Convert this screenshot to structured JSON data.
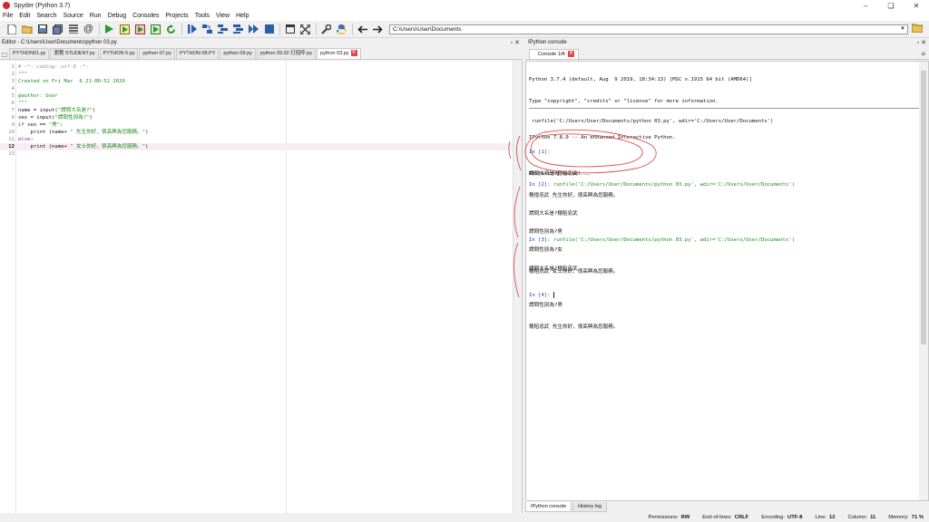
{
  "window": {
    "title": "Spyder (Python 3.7)",
    "minimize": "–",
    "maximize": "❏",
    "close": "✕"
  },
  "menu": [
    "File",
    "Edit",
    "Search",
    "Source",
    "Run",
    "Debug",
    "Consoles",
    "Projects",
    "Tools",
    "View",
    "Help"
  ],
  "toolbar": {
    "path": "C:\\Users\\User\\Documents",
    "icons": [
      "new-file-icon",
      "open-file-icon",
      "save-icon",
      "save-all-icon",
      "outline-icon",
      "at-icon",
      "run-icon",
      "run-cell-icon",
      "run-cell-advance-icon",
      "run-selection-icon",
      "rerun-icon",
      "debug-icon",
      "step-icon",
      "step-into-icon",
      "step-return-icon",
      "continue-icon",
      "stop-icon",
      "maximize-pane-icon",
      "fullscreen-icon",
      "preferences-icon",
      "python-path-icon",
      "back-arrow-icon",
      "forward-arrow-icon",
      "folder-icon"
    ]
  },
  "editor": {
    "title": "Editor - C:\\Users\\User\\Documents\\python 03.py",
    "tabs": [
      {
        "label": "PYTHON01.py",
        "active": false
      },
      {
        "label": "瀏覽 STUDENT.py",
        "active": false
      },
      {
        "label": "PYTHON 6.py",
        "active": false
      },
      {
        "label": "python 07.py",
        "active": false
      },
      {
        "label": "PYTHON 08.PY",
        "active": false
      },
      {
        "label": "python 09.py",
        "active": false
      },
      {
        "label": "python 09.02 打招呼.py",
        "active": false
      },
      {
        "label": "python 03.py",
        "active": true
      }
    ],
    "lines": [
      {
        "n": "1",
        "parts": [
          {
            "t": "# -*- coding: utf-8 -*-",
            "c": "c-com"
          }
        ]
      },
      {
        "n": "2",
        "parts": [
          {
            "t": "\"\"\"",
            "c": "c-str"
          }
        ]
      },
      {
        "n": "3",
        "parts": [
          {
            "t": "Created on Fri Mar  6 21:00:52 2020",
            "c": "c-str"
          }
        ]
      },
      {
        "n": "4",
        "parts": [
          {
            "t": "",
            "c": "c-str"
          }
        ]
      },
      {
        "n": "5",
        "parts": [
          {
            "t": "@author: User",
            "c": "c-str"
          }
        ]
      },
      {
        "n": "6",
        "parts": [
          {
            "t": "\"\"\"",
            "c": "c-str"
          }
        ]
      },
      {
        "n": "7",
        "parts": [
          {
            "t": "name = input(",
            "c": "c-txt"
          },
          {
            "t": "\"請問大名是?\"",
            "c": "c-str"
          },
          {
            "t": ")",
            "c": "c-txt"
          }
        ]
      },
      {
        "n": "8",
        "parts": [
          {
            "t": "sex = input(",
            "c": "c-txt"
          },
          {
            "t": "\"請問性別為?\"",
            "c": "c-str"
          },
          {
            "t": ")",
            "c": "c-txt"
          }
        ]
      },
      {
        "n": "9",
        "parts": [
          {
            "t": "if",
            "c": "c-kw"
          },
          {
            "t": " sex == ",
            "c": "c-txt"
          },
          {
            "t": "\"男\"",
            "c": "c-str"
          },
          {
            "t": ":",
            "c": "c-txt"
          }
        ]
      },
      {
        "n": "10",
        "parts": [
          {
            "t": "    print (name+ ",
            "c": "c-txt"
          },
          {
            "t": "\" 先生你好，很高興為您服務。\"",
            "c": "c-str"
          },
          {
            "t": ")",
            "c": "c-txt"
          }
        ]
      },
      {
        "n": "11",
        "parts": [
          {
            "t": "else",
            "c": "c-kw"
          },
          {
            "t": ":",
            "c": "c-txt"
          }
        ]
      },
      {
        "n": "12",
        "parts": [
          {
            "t": "    print (name+ ",
            "c": "c-txt"
          },
          {
            "t": "\" 女士你好，很高興為您服務。\"",
            "c": "c-str"
          },
          {
            "t": ")",
            "c": "c-txt"
          }
        ]
      },
      {
        "n": "13",
        "parts": [
          {
            "t": "",
            "c": "c-txt"
          }
        ]
      }
    ],
    "current_line": "12"
  },
  "console": {
    "title": "IPython console",
    "tab_label": "Console 1/A",
    "header": [
      "Python 3.7.4 (default, Aug  9 2019, 18:34:13) [MSC v.1915 64 bit (AMD64)]",
      "Type \"copyright\", \"credits\" or \"license\" for more information.",
      "",
      "IPython 7.8.0 -- An enhanced Interactive Python.",
      "",
      "Restarting kernel..."
    ],
    "first_run": " runfile('C:/Users/User/Documents/python 03.py', wdir='C:/Users/User/Documents')",
    "in1": "In [1]:",
    "block1": [
      "請問大名是?穗億忠武",
      "穗億忠武 先生你好，很高興為您服務。",
      "",
      "請問性別為?男"
    ],
    "in2_prompt": "In [2]:",
    "in2_cmd": " runfile('C:/Users/User/Documents/python 03.py', wdir='C:/Users/User/Documents')",
    "block2": [
      "請問大名是?穗稻忠武",
      "",
      "請問性別為?女",
      "穗稻忠武 女士你好，很高興為您服務。"
    ],
    "in3_prompt": "In [3]:",
    "in3_cmd": " runfile('C:/Users/User/Documents/python 03.py', wdir='C:/Users/User/Documents')",
    "block3": [
      "請問大名是?穗稻忠武",
      "",
      "請問性別為?男",
      "穗稻忠武 先生你好，很高興為您服務。"
    ],
    "in4_prompt": "In [4]:",
    "bottom_tabs": [
      "IPython console",
      "History log"
    ]
  },
  "status": {
    "permissions_label": "Permissions:",
    "permissions": "RW",
    "eol_label": "End-of-lines:",
    "eol": "CRLF",
    "encoding_label": "Encoding:",
    "encoding": "UTF-8",
    "line_label": "Line:",
    "line": "12",
    "column_label": "Column:",
    "column": "11",
    "memory_label": "Memory:",
    "memory": "71 %"
  },
  "colors": {
    "annotation": "#d9534f",
    "run": "#2a9a2a",
    "stop": "#2a5ea8",
    "tab_close": "#e3474b",
    "prompt": "#1d3fb0"
  }
}
